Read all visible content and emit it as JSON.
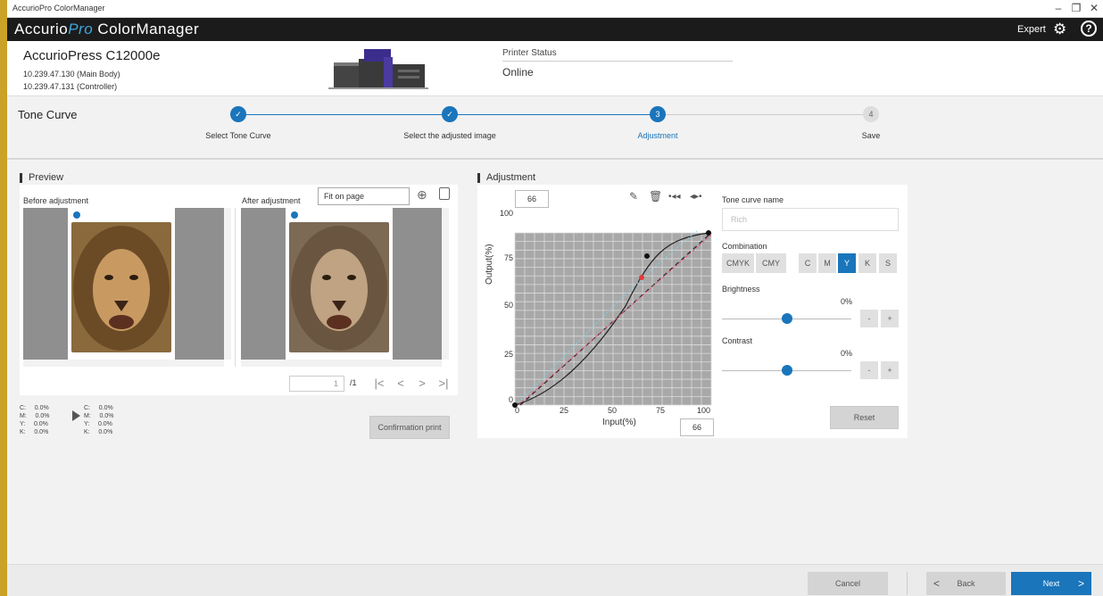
{
  "window": {
    "title": "AccurioPro ColorManager"
  },
  "app": {
    "logo_a": "Accurio",
    "logo_b": "Pro",
    "logo_c": " ColorManager",
    "mode_label": "Expert"
  },
  "device": {
    "name": "AccurioPress C12000e",
    "ip_main": "10.239.47.130 (Main Body)",
    "ip_controller": "10.239.47.131 (Controller)",
    "status_label": "Printer Status",
    "status_value": "Online"
  },
  "steps": {
    "title": "Tone Curve",
    "items": [
      {
        "num": "✓",
        "label": "Select Tone Curve",
        "state": "done"
      },
      {
        "num": "✓",
        "label": "Select the adjusted image",
        "state": "done"
      },
      {
        "num": "3",
        "label": "Adjustment",
        "state": "current"
      },
      {
        "num": "4",
        "label": "Save",
        "state": "todo"
      }
    ]
  },
  "preview": {
    "section_title": "Preview",
    "before_label": "Before adjustment",
    "after_label": "After adjustment",
    "fit_value": "Fit on page",
    "page_value": "1",
    "page_total": "/1",
    "readout_before": {
      "C": "0.0%",
      "M": "0.0%",
      "Y": "0.0%",
      "K": "0.0%"
    },
    "readout_after": {
      "C": "0.0%",
      "M": "0.0%",
      "Y": "0.0%",
      "K": "0.0%"
    },
    "confirmation_label": "Confirmation print"
  },
  "adjustment": {
    "section_title": "Adjustment",
    "output_value": "66",
    "input_value": "66",
    "x_label": "Input(%)",
    "y_label": "Output(%)",
    "x_ticks": [
      "0",
      "25",
      "50",
      "75",
      "100"
    ],
    "y_ticks": [
      "0",
      "25",
      "50",
      "75",
      "100"
    ],
    "tone_curve_name_label": "Tone curve name",
    "tone_curve_name_placeholder": "Rich",
    "combination_label": "Combination",
    "combination_options": [
      "CMYK",
      "CMY",
      "C",
      "M",
      "Y",
      "K",
      "S"
    ],
    "combination_selected": "Y",
    "brightness_label": "Brightness",
    "brightness_value": "0%",
    "contrast_label": "Contrast",
    "contrast_value": "0%",
    "minus": "-",
    "plus": "+",
    "reset_label": "Reset"
  },
  "footer": {
    "cancel": "Cancel",
    "back": "Back",
    "next": "Next"
  },
  "colors": {
    "accent": "#1a75bb",
    "pending": "#cccccc",
    "header_bg": "#1b1b1b",
    "frame": "#c9a227"
  }
}
